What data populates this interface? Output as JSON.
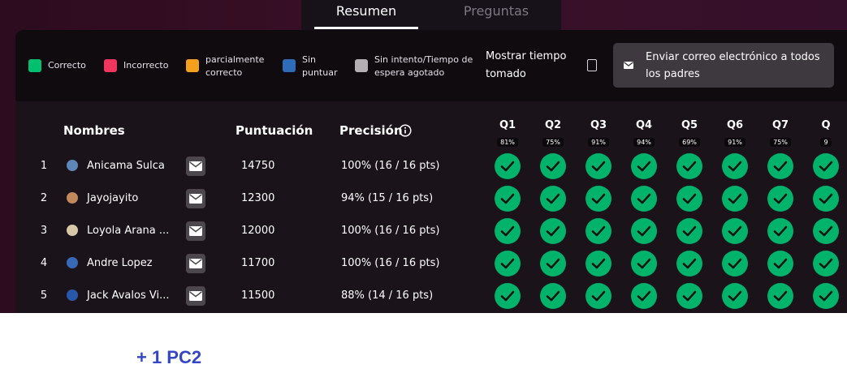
{
  "tabs": [
    {
      "label": "Resumen",
      "active": true
    },
    {
      "label": "Preguntas",
      "active": false
    }
  ],
  "legend": [
    {
      "label": "Correcto",
      "color": "#00c06f"
    },
    {
      "label": "Incorrecto",
      "color": "#f0355f"
    },
    {
      "label": "parcialmente correcto",
      "color": "#f4a01c"
    },
    {
      "label": "Sin puntuar",
      "color": "#2e6cb9"
    },
    {
      "label": "Sin intento/Tiempo de espera agotado",
      "color": "#b3b0b4"
    }
  ],
  "toggle": {
    "label": "Mostrar tiempo tomado",
    "checked": false
  },
  "email_all": {
    "label": "Enviar correo electrónico a todos los padres",
    "icon": "envelope-icon"
  },
  "table": {
    "headers": {
      "names": "Nombres",
      "score": "Puntuación",
      "precision": "Precisión"
    },
    "questions": [
      {
        "label": "Q1",
        "pct": "81%"
      },
      {
        "label": "Q2",
        "pct": "75%"
      },
      {
        "label": "Q3",
        "pct": "91%"
      },
      {
        "label": "Q4",
        "pct": "94%"
      },
      {
        "label": "Q5",
        "pct": "69%"
      },
      {
        "label": "Q6",
        "pct": "91%"
      },
      {
        "label": "Q7",
        "pct": "75%"
      },
      {
        "label": "Q",
        "pct": "9"
      }
    ],
    "rows": [
      {
        "rank": "1",
        "name": "Anicama Sulca",
        "score": "14750",
        "precision": "100% (16 / 16 pts)",
        "avatar_color": "#5e87b8"
      },
      {
        "rank": "2",
        "name": "Jayojayito",
        "score": "12300",
        "precision": "94% (15 / 16 pts)",
        "avatar_color": "#c08a5c"
      },
      {
        "rank": "3",
        "name": "Loyola Arana ...",
        "score": "12000",
        "precision": "100% (16 / 16 pts)",
        "avatar_color": "#d7c9a8"
      },
      {
        "rank": "4",
        "name": "Andre Lopez",
        "score": "11700",
        "precision": "100% (16 / 16 pts)",
        "avatar_color": "#3769b7"
      },
      {
        "rank": "5",
        "name": "Jack Avalos Vi...",
        "score": "11500",
        "precision": "88% (14 / 16 pts)",
        "avatar_color": "#2a58a8"
      }
    ]
  },
  "footer": {
    "text": "+ 1 PC2"
  }
}
